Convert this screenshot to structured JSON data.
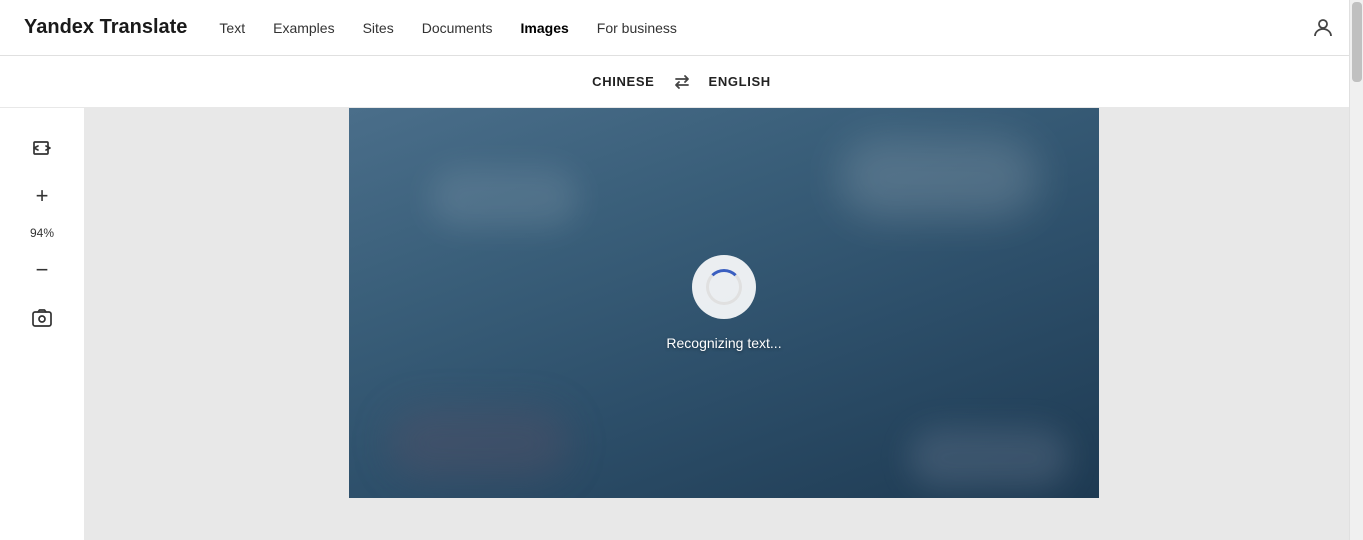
{
  "header": {
    "logo": "Yandex Translate",
    "nav": [
      {
        "label": "Text",
        "active": false
      },
      {
        "label": "Examples",
        "active": false
      },
      {
        "label": "Sites",
        "active": false
      },
      {
        "label": "Documents",
        "active": false
      },
      {
        "label": "Images",
        "active": true
      },
      {
        "label": "For business",
        "active": false
      }
    ]
  },
  "lang_bar": {
    "source": "CHINESE",
    "target": "ENGLISH",
    "swap_icon": "⇄"
  },
  "toolbar": {
    "fit_icon": "↩",
    "zoom_in_icon": "+",
    "zoom_value": "94%",
    "zoom_out_icon": "−",
    "screenshot_icon": "⊡"
  },
  "image": {
    "recognizing_text": "Recognizing text..."
  }
}
